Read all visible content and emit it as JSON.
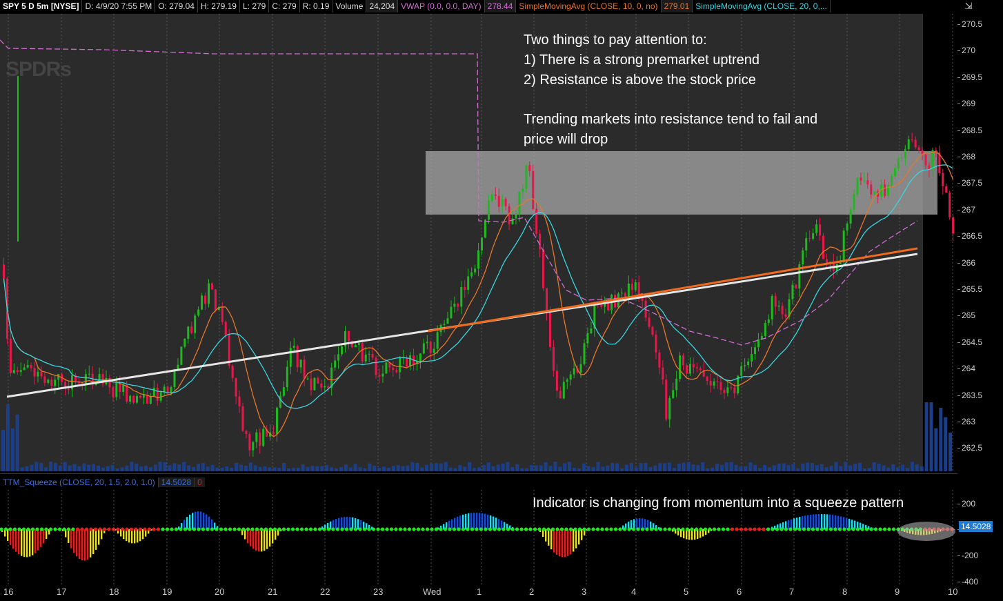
{
  "header": {
    "symbol": "SPY 5 D 5m [NYSE]",
    "date": "D: 4/9/20 7:55 PM",
    "open": "O: 279.04",
    "high": "H: 279.19",
    "low": "L: 279",
    "close": "C: 279",
    "range": "R: 0.19",
    "volume_label": "Volume",
    "volume_value": "24,204",
    "vwap_label": "VWAP (0.0, 0.0, DAY)",
    "vwap_value": "278.44",
    "sma10_label": "SimpleMovingAvg (CLOSE, 10, 0, no)",
    "sma10_value": "279.01",
    "sma20_label": "SimpleMovingAvg (CLOSE, 20, 0,..."
  },
  "watermark": "SPDRs",
  "annotation": {
    "line1": "Two things to pay attention to:",
    "line2": "1)  There is a strong premarket uptrend",
    "line3": "2)  Resistance is above the stock price",
    "line4": "Trending markets into resistance tend to fail and",
    "line5": "price will drop"
  },
  "price_axis": [
    "270.5",
    "270",
    "269.5",
    "269",
    "268.5",
    "268",
    "267.5",
    "267",
    "266.5",
    "266",
    "265.5",
    "265",
    "264.5",
    "264",
    "263.5",
    "263",
    "262.5"
  ],
  "squeeze": {
    "label": "TTM_Squeeze (CLOSE, 20, 1.5, 2.0, 1.0)",
    "value1": "14.5028",
    "value2": "0",
    "annotation": "Indicator is changing from momentum into a squeeze pattern",
    "badge": "14.5028",
    "axis": [
      "200",
      "0",
      "-200",
      "-400"
    ]
  },
  "x_axis": [
    "16",
    "17",
    "18",
    "19",
    "20",
    "21",
    "22",
    "23",
    "Wed",
    "1",
    "2",
    "3",
    "4",
    "5",
    "6",
    "7",
    "8",
    "9",
    "10"
  ],
  "colors": {
    "up": "#1fb81f",
    "down": "#e8174a",
    "sma10": "#e8762b",
    "sma20": "#3ad6e0",
    "vwap": "#d36bd3",
    "resistance": "#a8a8a8",
    "trend_white": "#e6e6e6",
    "trend_orange": "#f06a1e"
  }
}
